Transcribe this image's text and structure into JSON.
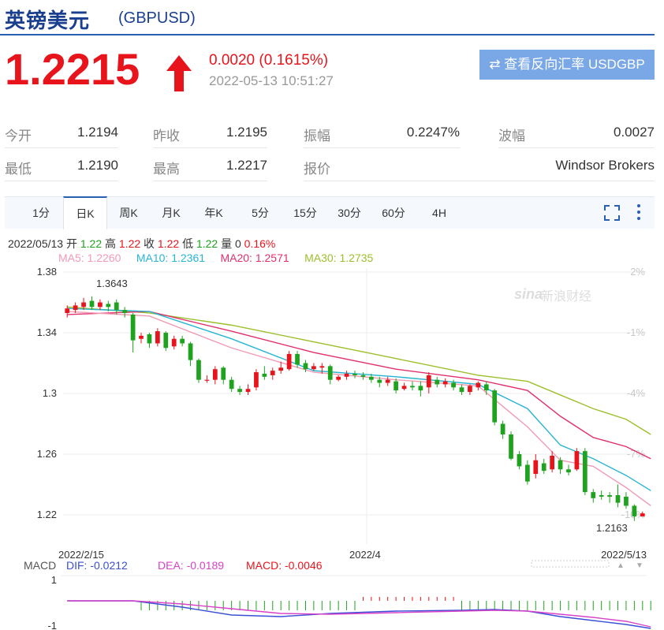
{
  "header": {
    "name": "英镑美元",
    "code": "(GBPUSD)"
  },
  "quote": {
    "price": "1.2215",
    "change": "0.0020 (0.1615%)",
    "time": "2022-05-13 10:51:27"
  },
  "reverse_button": {
    "label": "⇄ 查看反向汇率 USDGBP"
  },
  "stats": [
    {
      "label": "今开",
      "value": "1.2194"
    },
    {
      "label": "昨收",
      "value": "1.2195"
    },
    {
      "label": "振幅",
      "value": "0.2247%"
    },
    {
      "label": "波幅",
      "value": "0.0027"
    },
    {
      "label": "最低",
      "value": "1.2190"
    },
    {
      "label": "最高",
      "value": "1.2217"
    },
    {
      "label": "报价",
      "value": "Windsor Brokers"
    }
  ],
  "tabs": [
    "1分",
    "日K",
    "周K",
    "月K",
    "年K",
    "5分",
    "15分",
    "30分",
    "60分",
    "4H"
  ],
  "active_tab": "日K",
  "ohlc_info": {
    "date": "2022/05/13",
    "open_label": "开",
    "open": "1.22",
    "high_label": "高",
    "high": "1.22",
    "close_label": "收",
    "close": "1.22",
    "low_label": "低",
    "low": "1.22",
    "vol_label": "量",
    "vol": "0",
    "pct": "0.16%"
  },
  "ma_info": {
    "ma5": "MA5: 1.2260",
    "ma10": "MA10: 1.2361",
    "ma20": "MA20: 1.2571",
    "ma30": "MA30: 1.2735"
  },
  "macd_info": {
    "label": "MACD",
    "dif": "DIF: -0.0212",
    "dea": "DEA: -0.0189",
    "macd": "MACD: -0.0046"
  },
  "watermark": {
    "brand": "新浪财经"
  },
  "colors": {
    "up": "#e8141b",
    "down": "#1fa31f",
    "ma5": "#f29ab4",
    "ma10": "#27b5d2",
    "ma20": "#e0306b",
    "ma30": "#9dbf2c",
    "dif": "#3a4fd6",
    "dea": "#d842c8",
    "title": "#1a3f8f",
    "button": "#7aa7e6"
  },
  "chart_data": {
    "type": "candlestick",
    "ylim": [
      1.2,
      1.38
    ],
    "yticks": [
      "1.38",
      "1.34",
      "1.3",
      "1.26",
      "1.22"
    ],
    "pct_ticks": [
      "2%",
      "-1%",
      "-4%",
      "-7%",
      "-10%"
    ],
    "x_labels": [
      "2022/2/15",
      "2022/4",
      "2022/5/13"
    ],
    "high_annotation": "1.3643",
    "low_annotation": "1.2163",
    "macd_yticks": [
      "1",
      "-1"
    ],
    "candles": [
      {
        "o": 1.353,
        "c": 1.356,
        "h": 1.358,
        "l": 1.35
      },
      {
        "o": 1.355,
        "c": 1.358,
        "h": 1.36,
        "l": 1.353
      },
      {
        "o": 1.357,
        "c": 1.36,
        "h": 1.363,
        "l": 1.355
      },
      {
        "o": 1.361,
        "c": 1.357,
        "h": 1.364,
        "l": 1.355
      },
      {
        "o": 1.357,
        "c": 1.36,
        "h": 1.362,
        "l": 1.355
      },
      {
        "o": 1.359,
        "c": 1.357,
        "h": 1.361,
        "l": 1.354
      },
      {
        "o": 1.36,
        "c": 1.355,
        "h": 1.362,
        "l": 1.352
      },
      {
        "o": 1.355,
        "c": 1.353,
        "h": 1.357,
        "l": 1.35
      },
      {
        "o": 1.352,
        "c": 1.335,
        "h": 1.353,
        "l": 1.327
      },
      {
        "o": 1.336,
        "c": 1.338,
        "h": 1.34,
        "l": 1.333
      },
      {
        "o": 1.339,
        "c": 1.333,
        "h": 1.34,
        "l": 1.33
      },
      {
        "o": 1.333,
        "c": 1.341,
        "h": 1.343,
        "l": 1.331
      },
      {
        "o": 1.34,
        "c": 1.33,
        "h": 1.341,
        "l": 1.328
      },
      {
        "o": 1.331,
        "c": 1.336,
        "h": 1.338,
        "l": 1.329
      },
      {
        "o": 1.336,
        "c": 1.333,
        "h": 1.338,
        "l": 1.331
      },
      {
        "o": 1.333,
        "c": 1.322,
        "h": 1.334,
        "l": 1.318
      },
      {
        "o": 1.322,
        "c": 1.309,
        "h": 1.323,
        "l": 1.307
      },
      {
        "o": 1.309,
        "c": 1.309,
        "h": 1.312,
        "l": 1.307
      },
      {
        "o": 1.309,
        "c": 1.316,
        "h": 1.318,
        "l": 1.306
      },
      {
        "o": 1.317,
        "c": 1.309,
        "h": 1.318,
        "l": 1.306
      },
      {
        "o": 1.309,
        "c": 1.303,
        "h": 1.311,
        "l": 1.301
      },
      {
        "o": 1.303,
        "c": 1.301,
        "h": 1.305,
        "l": 1.299
      },
      {
        "o": 1.301,
        "c": 1.303,
        "h": 1.306,
        "l": 1.299
      },
      {
        "o": 1.304,
        "c": 1.314,
        "h": 1.316,
        "l": 1.302
      },
      {
        "o": 1.313,
        "c": 1.311,
        "h": 1.318,
        "l": 1.309
      },
      {
        "o": 1.312,
        "c": 1.315,
        "h": 1.317,
        "l": 1.309
      },
      {
        "o": 1.315,
        "c": 1.317,
        "h": 1.321,
        "l": 1.313
      },
      {
        "o": 1.316,
        "c": 1.326,
        "h": 1.328,
        "l": 1.315
      },
      {
        "o": 1.326,
        "c": 1.319,
        "h": 1.328,
        "l": 1.317
      },
      {
        "o": 1.32,
        "c": 1.316,
        "h": 1.322,
        "l": 1.314
      },
      {
        "o": 1.316,
        "c": 1.318,
        "h": 1.32,
        "l": 1.315
      },
      {
        "o": 1.317,
        "c": 1.318,
        "h": 1.32,
        "l": 1.313
      },
      {
        "o": 1.318,
        "c": 1.309,
        "h": 1.319,
        "l": 1.306
      },
      {
        "o": 1.309,
        "c": 1.311,
        "h": 1.312,
        "l": 1.308
      },
      {
        "o": 1.311,
        "c": 1.313,
        "h": 1.315,
        "l": 1.309
      },
      {
        "o": 1.313,
        "c": 1.312,
        "h": 1.315,
        "l": 1.31
      },
      {
        "o": 1.312,
        "c": 1.311,
        "h": 1.314,
        "l": 1.309
      },
      {
        "o": 1.311,
        "c": 1.309,
        "h": 1.313,
        "l": 1.307
      },
      {
        "o": 1.309,
        "c": 1.307,
        "h": 1.311,
        "l": 1.304
      },
      {
        "o": 1.307,
        "c": 1.309,
        "h": 1.311,
        "l": 1.305
      },
      {
        "o": 1.308,
        "c": 1.302,
        "h": 1.31,
        "l": 1.3
      },
      {
        "o": 1.303,
        "c": 1.305,
        "h": 1.307,
        "l": 1.302
      },
      {
        "o": 1.305,
        "c": 1.304,
        "h": 1.308,
        "l": 1.302
      },
      {
        "o": 1.305,
        "c": 1.302,
        "h": 1.308,
        "l": 1.298
      },
      {
        "o": 1.304,
        "c": 1.312,
        "h": 1.314,
        "l": 1.3
      },
      {
        "o": 1.309,
        "c": 1.306,
        "h": 1.311,
        "l": 1.304
      },
      {
        "o": 1.306,
        "c": 1.308,
        "h": 1.31,
        "l": 1.304
      },
      {
        "o": 1.307,
        "c": 1.304,
        "h": 1.309,
        "l": 1.302
      },
      {
        "o": 1.304,
        "c": 1.301,
        "h": 1.306,
        "l": 1.299
      },
      {
        "o": 1.301,
        "c": 1.305,
        "h": 1.306,
        "l": 1.299
      },
      {
        "o": 1.304,
        "c": 1.307,
        "h": 1.308,
        "l": 1.302
      },
      {
        "o": 1.306,
        "c": 1.302,
        "h": 1.308,
        "l": 1.299
      },
      {
        "o": 1.302,
        "c": 1.281,
        "h": 1.303,
        "l": 1.279
      },
      {
        "o": 1.28,
        "c": 1.273,
        "h": 1.282,
        "l": 1.27
      },
      {
        "o": 1.273,
        "c": 1.257,
        "h": 1.275,
        "l": 1.256
      },
      {
        "o": 1.26,
        "c": 1.252,
        "h": 1.262,
        "l": 1.25
      },
      {
        "o": 1.253,
        "c": 1.242,
        "h": 1.256,
        "l": 1.24
      },
      {
        "o": 1.247,
        "c": 1.256,
        "h": 1.26,
        "l": 1.244
      },
      {
        "o": 1.254,
        "c": 1.249,
        "h": 1.257,
        "l": 1.247
      },
      {
        "o": 1.25,
        "c": 1.259,
        "h": 1.262,
        "l": 1.248
      },
      {
        "o": 1.256,
        "c": 1.25,
        "h": 1.258,
        "l": 1.247
      },
      {
        "o": 1.25,
        "c": 1.248,
        "h": 1.253,
        "l": 1.246
      },
      {
        "o": 1.25,
        "c": 1.262,
        "h": 1.264,
        "l": 1.249
      },
      {
        "o": 1.262,
        "c": 1.235,
        "h": 1.264,
        "l": 1.233
      },
      {
        "o": 1.235,
        "c": 1.231,
        "h": 1.237,
        "l": 1.228
      },
      {
        "o": 1.233,
        "c": 1.232,
        "h": 1.236,
        "l": 1.23
      },
      {
        "o": 1.233,
        "c": 1.232,
        "h": 1.235,
        "l": 1.228
      },
      {
        "o": 1.233,
        "c": 1.228,
        "h": 1.24,
        "l": 1.225
      },
      {
        "o": 1.232,
        "c": 1.226,
        "h": 1.235,
        "l": 1.224
      },
      {
        "o": 1.226,
        "c": 1.219,
        "h": 1.227,
        "l": 1.216
      },
      {
        "o": 1.219,
        "c": 1.221,
        "h": 1.222,
        "l": 1.219
      }
    ],
    "ma5": [
      [
        0,
        1.354
      ],
      [
        10,
        1.351
      ],
      [
        20,
        1.33
      ],
      [
        30,
        1.314
      ],
      [
        40,
        1.309
      ],
      [
        50,
        1.305
      ],
      [
        56,
        1.278
      ],
      [
        60,
        1.256
      ],
      [
        64,
        1.252
      ],
      [
        68,
        1.238
      ],
      [
        71,
        1.226
      ]
    ],
    "ma10": [
      [
        0,
        1.356
      ],
      [
        10,
        1.354
      ],
      [
        20,
        1.336
      ],
      [
        30,
        1.315
      ],
      [
        40,
        1.311
      ],
      [
        50,
        1.306
      ],
      [
        56,
        1.29
      ],
      [
        60,
        1.266
      ],
      [
        64,
        1.257
      ],
      [
        68,
        1.246
      ],
      [
        71,
        1.236
      ]
    ],
    "ma20": [
      [
        0,
        1.352
      ],
      [
        10,
        1.354
      ],
      [
        20,
        1.341
      ],
      [
        30,
        1.327
      ],
      [
        40,
        1.316
      ],
      [
        50,
        1.309
      ],
      [
        56,
        1.302
      ],
      [
        60,
        1.285
      ],
      [
        64,
        1.271
      ],
      [
        68,
        1.265
      ],
      [
        71,
        1.257
      ]
    ],
    "ma30": [
      [
        0,
        1.357
      ],
      [
        10,
        1.353
      ],
      [
        20,
        1.345
      ],
      [
        30,
        1.334
      ],
      [
        40,
        1.323
      ],
      [
        50,
        1.312
      ],
      [
        56,
        1.308
      ],
      [
        60,
        1.299
      ],
      [
        64,
        1.29
      ],
      [
        68,
        1.283
      ],
      [
        71,
        1.273
      ]
    ],
    "macd_hist_sign": [
      0,
      0,
      0,
      0,
      0,
      0,
      0,
      0,
      0,
      -1,
      -1,
      -1,
      -1,
      -1,
      -1,
      -1,
      -1,
      -1,
      -1,
      -1,
      -1,
      -1,
      -1,
      -1,
      -1,
      -1,
      -1,
      -1,
      -1,
      -1,
      -1,
      -1,
      -1,
      -1,
      -1,
      -1,
      1,
      1,
      1,
      1,
      1,
      1,
      1,
      1,
      1,
      1,
      1,
      1,
      -1,
      -1,
      -1,
      -1,
      -1,
      -1,
      -1,
      -1,
      -1,
      -1,
      -1,
      -1,
      -1,
      -1,
      -1,
      -1,
      -1,
      -1,
      -1,
      -1,
      -1,
      -1,
      -1,
      -1
    ]
  }
}
